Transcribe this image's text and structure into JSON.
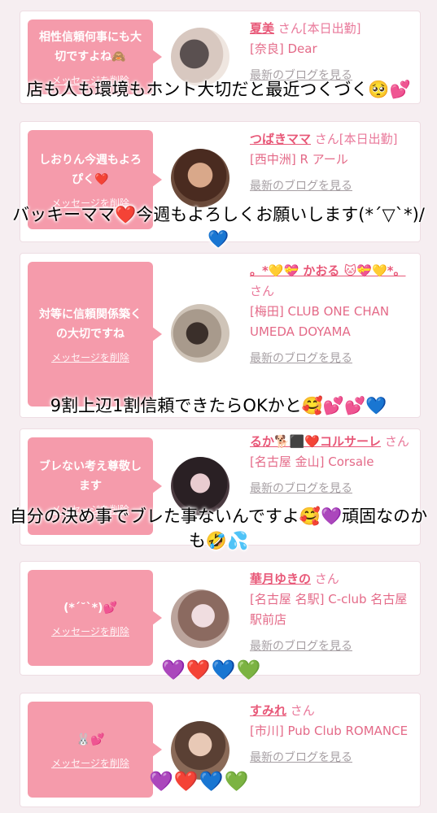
{
  "cards": [
    {
      "message": "相性信頼何事にも大切ですよね🙈",
      "delete_label": "メッセージを削除",
      "name": "夏美",
      "suffix": "さん[本日出勤]",
      "shop": "[奈良] Dear",
      "blog_label": "最新のブログを見る"
    },
    {
      "message": "しおりん今週もよろぴく❤️",
      "delete_label": "メッセージを削除",
      "name": "つばきママ",
      "suffix": "さん[本日出勤]",
      "shop": "[西中洲] R アール",
      "blog_label": "最新のブログを見る"
    },
    {
      "message": "対等に信頼関係築くの大切ですね",
      "delete_label": "メッセージを削除",
      "name": "。*💛💝 かおる 🐱💝💛*。",
      "suffix": "さん",
      "shop": "[梅田] CLUB ONE CHAN UMEDA DOYAMA",
      "blog_label": "最新のブログを見る"
    },
    {
      "message": "ブレない考え尊敬します",
      "delete_label": "メッセージを削除",
      "name": "るか🐕⬛❤️コルサーレ",
      "suffix": "さん",
      "shop": "[名古屋 金山] Corsale",
      "blog_label": "最新のブログを見る"
    },
    {
      "message": "(*´˘`*)💕",
      "delete_label": "メッセージを削除",
      "name": "華月ゆきの",
      "suffix": "さん",
      "shop": "[名古屋 名駅] C-club 名古屋駅前店",
      "blog_label": "最新のブログを見る"
    },
    {
      "message": "🐰💕",
      "delete_label": "メッセージを削除",
      "name": "すみれ",
      "suffix": "さん",
      "shop": "[市川] Pub Club ROMANCE",
      "blog_label": "最新のブログを見る"
    }
  ],
  "overlays": [
    "店も人も環境もホント大切だと最近つくづく🥺💕",
    "バッキーママ❤️今週もよろしくお願いします(*´▽`*)/💙",
    "9割上辺1割信頼できたらOKかと🥰💕💕💙",
    "自分の決め事でブレた事ないんですよ🥰💜頑固なのかも🤣💦",
    "💜❤️💙💚",
    "💜❤️💙💚"
  ],
  "colors": {
    "bubble": "#f59bab",
    "name": "#e85878",
    "page_bg": "#f6eef1"
  }
}
